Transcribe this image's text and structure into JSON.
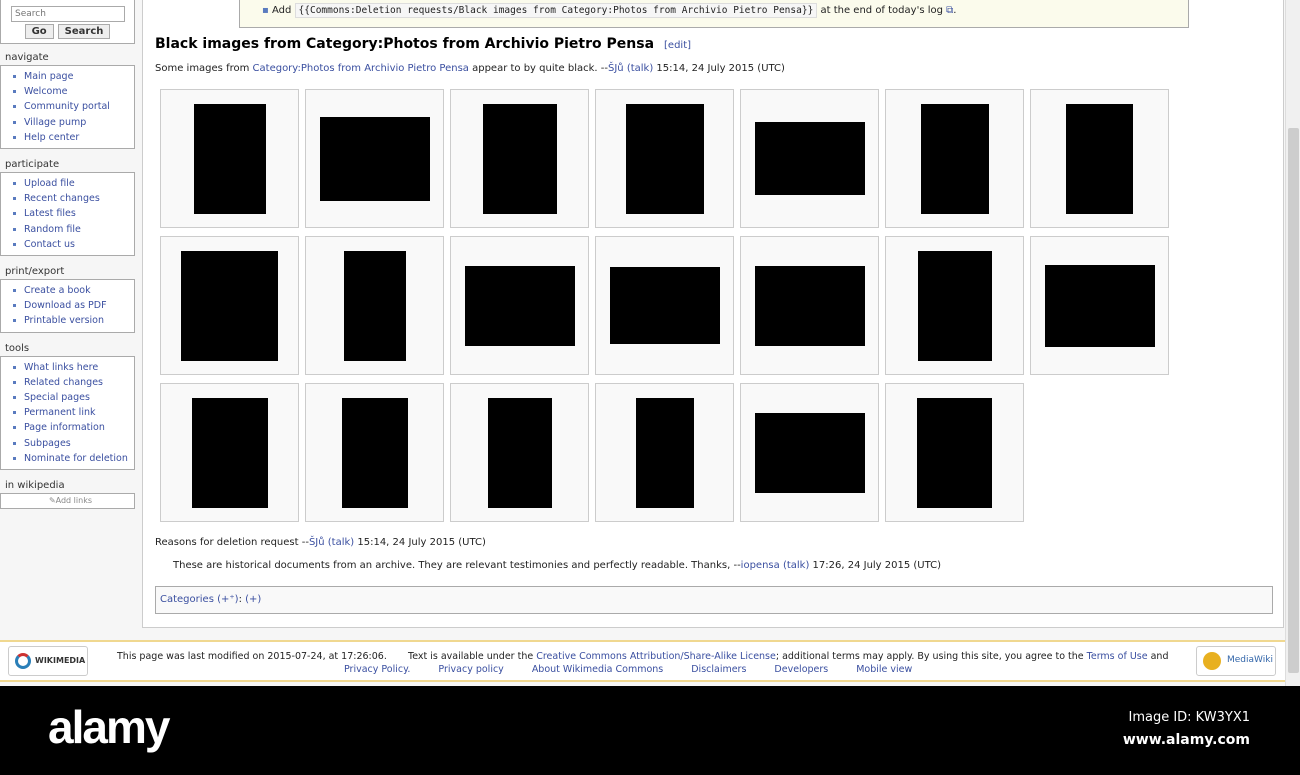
{
  "search": {
    "placeholder": "Search",
    "go": "Go",
    "search": "Search"
  },
  "sidebar": [
    {
      "title": "navigate",
      "items": [
        "Main page",
        "Welcome",
        "Community portal",
        "Village pump",
        "Help center"
      ]
    },
    {
      "title": "participate",
      "items": [
        "Upload file",
        "Recent changes",
        "Latest files",
        "Random file",
        "Contact us"
      ]
    },
    {
      "title": "print/export",
      "items": [
        "Create a book",
        "Download as PDF",
        "Printable version"
      ]
    },
    {
      "title": "tools",
      "items": [
        "What links here",
        "Related changes",
        "Special pages",
        "Permanent link",
        "Page information",
        "Subpages",
        "Nominate for deletion"
      ]
    }
  ],
  "inwiki": {
    "title": "in wikipedia",
    "add_links": "Add links"
  },
  "notice": {
    "add": "Add",
    "code": "{{Commons:Deletion requests/Black images from Category:Photos from Archivio Pietro Pensa}}",
    "tail": "at the end of today's log"
  },
  "heading": {
    "title": "Black images from Category:Photos from Archivio Pietro Pensa",
    "edit": "[edit]"
  },
  "intro": {
    "pre": "Some images from ",
    "link": "Category:Photos from Archivio Pietro Pensa",
    "post": " appear to by quite black. --",
    "user": "ŠJů",
    "talk": "(talk)",
    "date": " 15:14, 24 July 2015 (UTC)"
  },
  "reasons": {
    "pre": "Reasons for deletion request --",
    "user": "ŠJů",
    "talk": "(talk)",
    "date": " 15:14, 24 July 2015 (UTC)"
  },
  "reply": {
    "pre": "These are historical documents from an archive. They are relevant testimonies and perfectly readable. Thanks, --",
    "user": "iopensa",
    "talk": "(talk)",
    "date": " 17:26, 24 July 2015 (UTC)"
  },
  "categories": {
    "label": "Categories",
    "plus": "(+⁺)",
    "add": "(+)"
  },
  "footer": {
    "wm": "WIKIMEDIA",
    "mw": "MediaWiki",
    "modified": "This page was last modified on 2015-07-24, at 17:26:06.",
    "license_pre": "Text is available under the ",
    "license": "Creative Commons Attribution/Share-Alike License",
    "license_post": "; additional terms may apply. By using this site, you agree to the ",
    "terms": "Terms of Use",
    "and": " and",
    "links": [
      "Privacy Policy.",
      "Privacy policy",
      "About Wikimedia Commons",
      "Disclaimers",
      "Developers",
      "Mobile view"
    ]
  },
  "watermark": {
    "brand": "alamy",
    "image_id": "Image ID: KW3YX1",
    "site": "www.alamy.com"
  }
}
